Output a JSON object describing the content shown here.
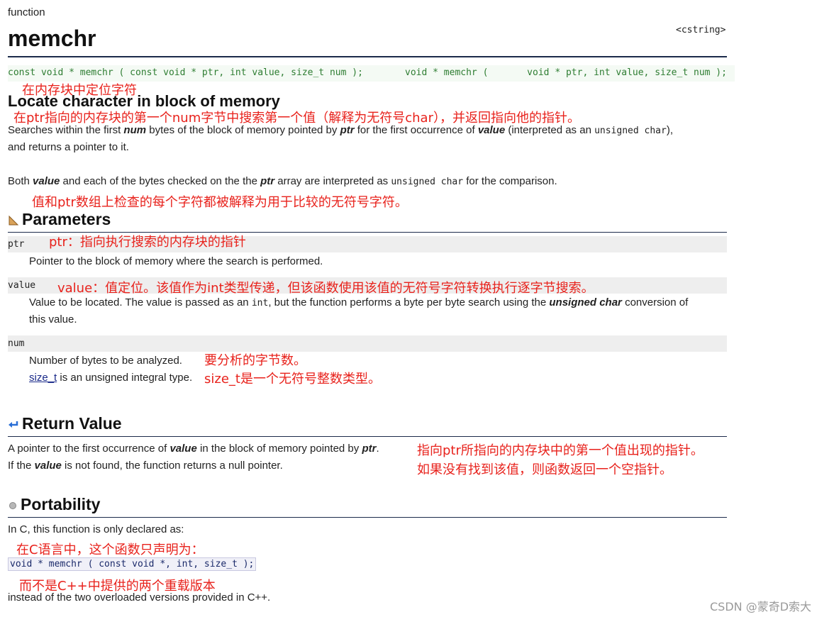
{
  "kind_label": "function",
  "title": "memchr",
  "header_lib": "<cstring>",
  "proto_const": "const void * memchr ( const void * ptr, int value, size_t num );",
  "proto_nonconst": "void * memchr (       void * ptr, int value, size_t num );",
  "heading": "Locate character in block of memory",
  "desc": {
    "p1_a": "Searches within the first ",
    "p1_num": "num",
    "p1_b": " bytes of the block of memory pointed by ",
    "p1_ptr": "ptr",
    "p1_c": " for the first occurrence of ",
    "p1_value": "value",
    "p1_d": " (interpreted as an ",
    "p1_code": "unsigned char",
    "p1_e": "),",
    "p1_line2": "and returns a pointer to it.",
    "p2_a": "Both ",
    "p2_value": "value",
    "p2_b": " and each of the bytes checked on the the ",
    "p2_ptr": "ptr",
    "p2_c": " array are interpreted as ",
    "p2_code": "unsigned char",
    "p2_d": " for the comparison."
  },
  "parameters": {
    "heading": "Parameters",
    "ptr_name": "ptr",
    "ptr_desc": "Pointer to the block of memory where the search is performed.",
    "value_name": "value",
    "value_desc_a": "Value to be located. The value is passed as an ",
    "value_desc_code": "int",
    "value_desc_b": ", but the function performs a byte per byte search using the ",
    "value_desc_bold": "unsigned char",
    "value_desc_c": " conversion of",
    "value_desc_line2": "this value.",
    "num_name": "num",
    "num_desc": "Number of bytes to be analyzed.",
    "num_link": "size_t",
    "num_desc2": " is an unsigned integral type."
  },
  "return_value": {
    "heading": "Return Value",
    "l1_a": "A pointer to the first occurrence of ",
    "l1_value": "value",
    "l1_b": " in the block of memory pointed by ",
    "l1_ptr": "ptr",
    "l1_c": ".",
    "l2_a": "If the ",
    "l2_value": "value",
    "l2_b": " is not found, the function returns a null pointer."
  },
  "portability": {
    "heading": "Portability",
    "intro": "In C, this function is only declared as:",
    "code": "void * memchr ( const void *, int, size_t );",
    "outro": "instead of the two overloaded versions provided in C++."
  },
  "notes": {
    "heading_cn": "在内存块中定位字符",
    "desc_cn": "在ptr指向的内存块的第一个num字节中搜索第一个值（解释为无符号char），并返回指向他的指针。",
    "compare_cn": "值和ptr数组上检查的每个字符都被解释为用于比较的无符号字符。",
    "ptr_cn": "ptr：指向执行搜索的内存块的指针",
    "value_cn": "value：值定位。该值作为int类型传递，但该函数使用该值的无符号字符转换执行逐字节搜索。",
    "num_cn": "要分析的字节数。",
    "sizet_cn": "size_t是一个无符号整数类型。",
    "ret1_cn": "指向ptr所指向的内存块中的第一个值出现的指针。",
    "ret2_cn": "如果没有找到该值，则函数返回一个空指针。",
    "port1_cn": "在C语言中，这个函数只声明为：",
    "port2_cn": "而不是C++中提供的两个重载版本"
  },
  "watermark": "CSDN @蒙奇D索大",
  "icons": [
    "parameters-icon",
    "return-icon",
    "bullet-icon"
  ],
  "colors": {
    "note_red": "#e8221c",
    "proto_green": "#2e7d32",
    "rule_navy": "#1b2a4a"
  }
}
